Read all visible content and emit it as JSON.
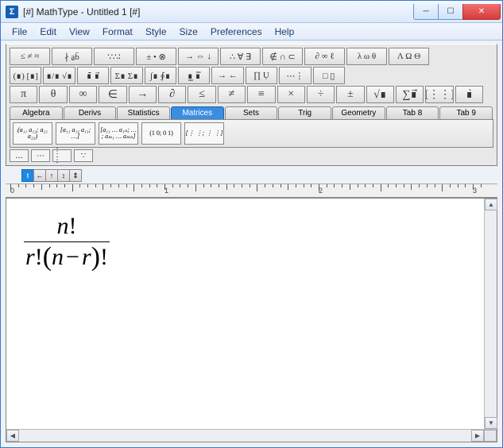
{
  "window": {
    "app_icon_text": "Σ",
    "title": "[#] MathType - Untitled 1 [#]"
  },
  "menu": [
    "File",
    "Edit",
    "View",
    "Format",
    "Style",
    "Size",
    "Preferences",
    "Help"
  ],
  "palettes": {
    "row1": [
      "≤ ≠ ≈",
      "∤ a̱b̄",
      "∵∴∶",
      "± • ⊗",
      "→ ⇔ ↓",
      "∴ ∀ ∃",
      "∉ ∩ ⊂",
      "∂ ∞ ℓ",
      "λ ω θ",
      "Λ Ω Θ"
    ],
    "row2": [
      "(∎) [∎]",
      "∎/∎ √∎",
      "∎̄ ∎⃗",
      "Σ∎ Σ∎",
      "∫∎ ∮∎",
      "∎̲ ∎̅",
      "→ ←",
      "∏ Ụ",
      "⋯⋮",
      "□ ▯"
    ],
    "row3": [
      "π",
      "θ",
      "∞",
      "∈",
      "→",
      "∂",
      "≤",
      "≠",
      "≡",
      "×",
      "÷",
      "±",
      "√∎",
      "∑∎⃗",
      "[⋮⋮]",
      "∎̇"
    ]
  },
  "tabs": {
    "items": [
      "Algebra",
      "Derivs",
      "Statistics",
      "Matrices",
      "Sets",
      "Trig",
      "Geometry",
      "Tab 8",
      "Tab 9"
    ],
    "active_index": 3
  },
  "matrix_buttons": [
    "(a₁₁ a₁₂; a₂₁ a₂₂)",
    "[a₁₁ a₁₂ a₁₃; …]",
    "[a₁₁ … a₁ₙ; … ; aₘ₁ … aₘₙ]",
    "(1 0; 0 1)",
    "[⋮ ⋮; ⋮ ⋮]"
  ],
  "extra_buttons": [
    "…",
    "⋯",
    "⋮ ⋮",
    "∵"
  ],
  "small_toolbar": [
    "t",
    "←",
    "↑",
    "↕",
    "⇕"
  ],
  "ruler": {
    "marks": [
      "0",
      "1",
      "2",
      "3"
    ]
  },
  "equation": {
    "numerator_var": "n",
    "numerator_bang": "!",
    "den_r": "r",
    "den_bang1": "!",
    "den_lp": "(",
    "den_n": "n",
    "den_minus": "−",
    "den_r2": "r",
    "den_rp": ")",
    "den_bang2": "!"
  }
}
